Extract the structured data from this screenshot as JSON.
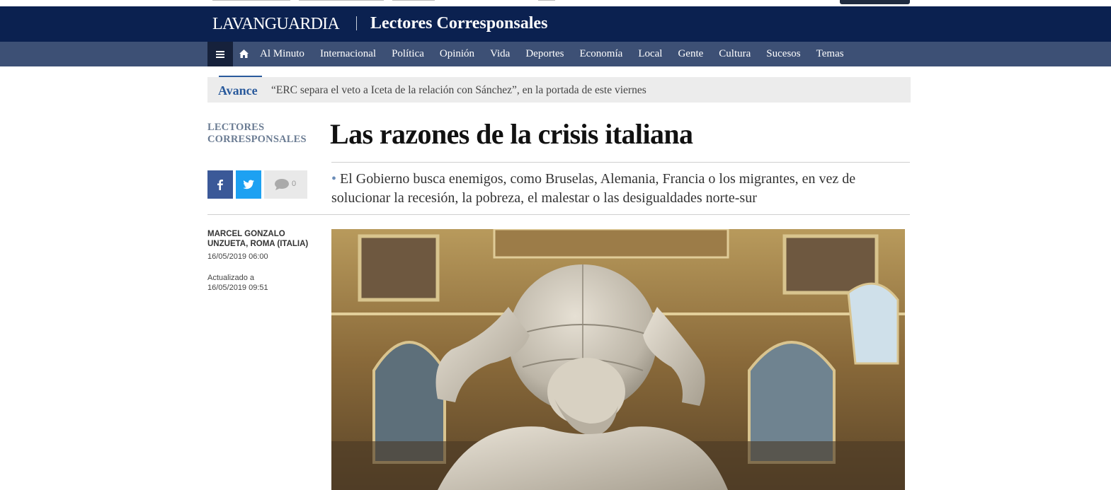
{
  "header": {
    "brand": "LAVANGUARDIA",
    "section": "Lectores Corresponsales",
    "brand_color": "#0b2150",
    "nav_color": "#3d5075"
  },
  "nav": {
    "menu_icon": "hamburger-icon",
    "home_icon": "home-icon",
    "items": [
      "Al Minuto",
      "Internacional",
      "Política",
      "Opinión",
      "Vida",
      "Deportes",
      "Economía",
      "Local",
      "Gente",
      "Cultura",
      "Sucesos",
      "Temas"
    ]
  },
  "avance": {
    "label": "Avance",
    "text": "“ERC separa el veto a Iceta de la relación con Sánchez”, en la portada de este viernes",
    "accent_color": "#2a5a9c"
  },
  "article": {
    "kicker_line1": "LECTORES",
    "kicker_line2": "CORRESPONSALES",
    "headline": "Las razones de la crisis italiana",
    "subtitle": "El Gobierno busca enemigos, como Bruselas, Alemania, Francia o los migrantes, en vez de solucionar la recesión, la pobreza, el malestar o las desigualdades norte-sur",
    "author": "Marcel Gonzalo Unzueta, Roma (Italia)",
    "published": "16/05/2019 06:00",
    "updated_label": "Actualizado a",
    "updated": "16/05/2019 09:51"
  },
  "share": {
    "facebook_icon": "facebook-icon",
    "twitter_icon": "twitter-icon",
    "comment_icon": "comment-icon",
    "comment_count": "0",
    "facebook_color": "#3b5998",
    "twitter_color": "#1da1f2"
  },
  "image": {
    "subject": "photo of marble Atlas statue holding a globe in an ornate gilded hall"
  }
}
